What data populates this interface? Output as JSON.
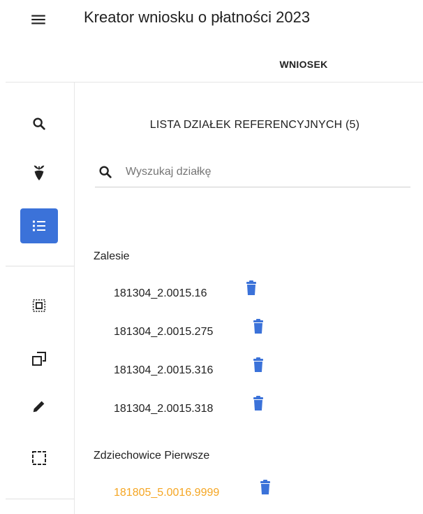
{
  "app": {
    "title": "Kreator wniosku o płatności 2023"
  },
  "tabs": [
    {
      "label": "WNIOSEK"
    }
  ],
  "sidebar": {
    "tools": [
      {
        "icon": "search-icon",
        "active": false
      },
      {
        "icon": "crop-plant-icon",
        "active": false
      },
      {
        "icon": "list-icon",
        "active": true
      },
      {
        "icon": "select-all-icon",
        "active": false
      },
      {
        "icon": "copy-shape-icon",
        "active": false
      },
      {
        "icon": "pencil-icon",
        "active": false
      },
      {
        "icon": "dashed-rectangle-icon",
        "active": false
      }
    ]
  },
  "panel": {
    "title": "LISTA DZIAŁEK REFERENCYJNYCH (5)",
    "search": {
      "placeholder": "Wyszukaj działkę",
      "value": ""
    },
    "groups": [
      {
        "name": "Zalesie",
        "parcels": [
          {
            "id": "181304_2.0015.16",
            "highlighted": false
          },
          {
            "id": "181304_2.0015.275",
            "highlighted": false
          },
          {
            "id": "181304_2.0015.316",
            "highlighted": false
          },
          {
            "id": "181304_2.0015.318",
            "highlighted": false
          }
        ]
      },
      {
        "name": "Zdziechowice Pierwsze",
        "parcels": [
          {
            "id": "181805_5.0016.9999",
            "highlighted": true
          }
        ]
      }
    ]
  },
  "colors": {
    "accent": "#3b72d9",
    "trash": "#3b72d9",
    "highlight": "#f5a623",
    "text": "#212121",
    "divider": "#e6e6e6"
  }
}
